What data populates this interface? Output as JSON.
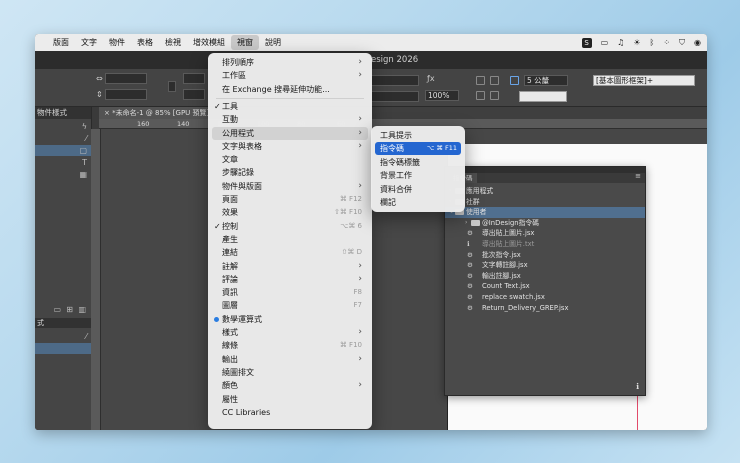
{
  "menubar": {
    "items": [
      "版面",
      "文字",
      "物件",
      "表格",
      "檢視",
      "增效模組",
      "視窗",
      "說明"
    ],
    "active_index": 6,
    "tray_icons": [
      "s-badge-icon",
      "screen-icon",
      "bell-icon",
      "sun-icon",
      "bluetooth-icon",
      "dots-icon",
      "shield-icon",
      "eye-icon"
    ]
  },
  "app_title": "esign 2026",
  "document_tab": "×  *未命名-1 @ 85% [GPU 預覽]",
  "left_panel": {
    "header": "物件樣式",
    "lower_header": "式"
  },
  "ruler": {
    "ticks": [
      "160",
      "140",
      "120",
      "100",
      "80",
      "60"
    ]
  },
  "control_bar": {
    "stroke_weight": "5 公釐",
    "zoom": "100%",
    "frame_style": "[基本圖形框架]+"
  },
  "window_menu": {
    "items": [
      {
        "label": "排列順序",
        "submenu": true
      },
      {
        "label": "工作區",
        "submenu": true
      },
      {
        "label": "在 Exchange 搜尋延伸功能..."
      },
      {
        "separator": true
      },
      {
        "label": "工具",
        "checked": true
      },
      {
        "label": "互動",
        "submenu": true
      },
      {
        "label": "公用程式",
        "submenu": true,
        "highlighted": true
      },
      {
        "label": "文字與表格",
        "submenu": true
      },
      {
        "label": "文章"
      },
      {
        "label": "步驟記錄"
      },
      {
        "label": "物件與版面",
        "submenu": true
      },
      {
        "label": "頁面",
        "shortcut": "⌘ F12"
      },
      {
        "label": "效果",
        "shortcut": "⇧⌘ F10"
      },
      {
        "label": "控制",
        "checked": true,
        "shortcut": "⌥⌘ 6"
      },
      {
        "label": "產生"
      },
      {
        "label": "連結",
        "shortcut": "⇧⌘ D"
      },
      {
        "label": "註解",
        "submenu": true
      },
      {
        "label": "評論",
        "submenu": true
      },
      {
        "label": "資訊",
        "shortcut": "F8"
      },
      {
        "label": "圖層",
        "shortcut": "F7"
      },
      {
        "label": "數學運算式",
        "dot": true
      },
      {
        "label": "樣式",
        "submenu": true
      },
      {
        "label": "線條",
        "shortcut": "⌘ F10"
      },
      {
        "label": "輸出",
        "submenu": true
      },
      {
        "label": "繞圖排文"
      },
      {
        "label": "顏色",
        "submenu": true
      },
      {
        "label": "屬性"
      },
      {
        "label": "CC Libraries"
      }
    ]
  },
  "utilities_submenu": {
    "items": [
      {
        "label": "工具提示"
      },
      {
        "label": "指令碼",
        "shortcut": "⌥ ⌘ F11",
        "selected": true
      },
      {
        "label": "指令碼標籤"
      },
      {
        "label": "背景工作"
      },
      {
        "label": "資料合併"
      },
      {
        "label": "欄記"
      }
    ]
  },
  "scripts_panel": {
    "tab": "指令碼",
    "rows": [
      {
        "label": "應用程式",
        "type": "folder",
        "level": 0,
        "twisty": "›"
      },
      {
        "label": "社群",
        "type": "folder",
        "level": 0,
        "twisty": "›"
      },
      {
        "label": "使用者",
        "type": "folder",
        "level": 0,
        "twisty": "⌄",
        "selected": true
      },
      {
        "label": "@InDesign指令碼",
        "type": "folder",
        "level": 1,
        "twisty": "›"
      },
      {
        "label": "導出貼上圖片.jsx",
        "type": "script",
        "level": 1
      },
      {
        "label": "導出貼上圖片.txt",
        "type": "info",
        "level": 1,
        "dim": true
      },
      {
        "label": "批次指令.jsx",
        "type": "script",
        "level": 1
      },
      {
        "label": "文字轉註腳.jsx",
        "type": "script",
        "level": 1
      },
      {
        "label": "輸出註腳.jsx",
        "type": "script",
        "level": 1
      },
      {
        "label": "Count Text.jsx",
        "type": "script",
        "level": 1
      },
      {
        "label": "replace swatch.jsx",
        "type": "script",
        "level": 1
      },
      {
        "label": "Return_Delivery_GREP.jsx",
        "type": "script",
        "level": 1
      }
    ]
  }
}
